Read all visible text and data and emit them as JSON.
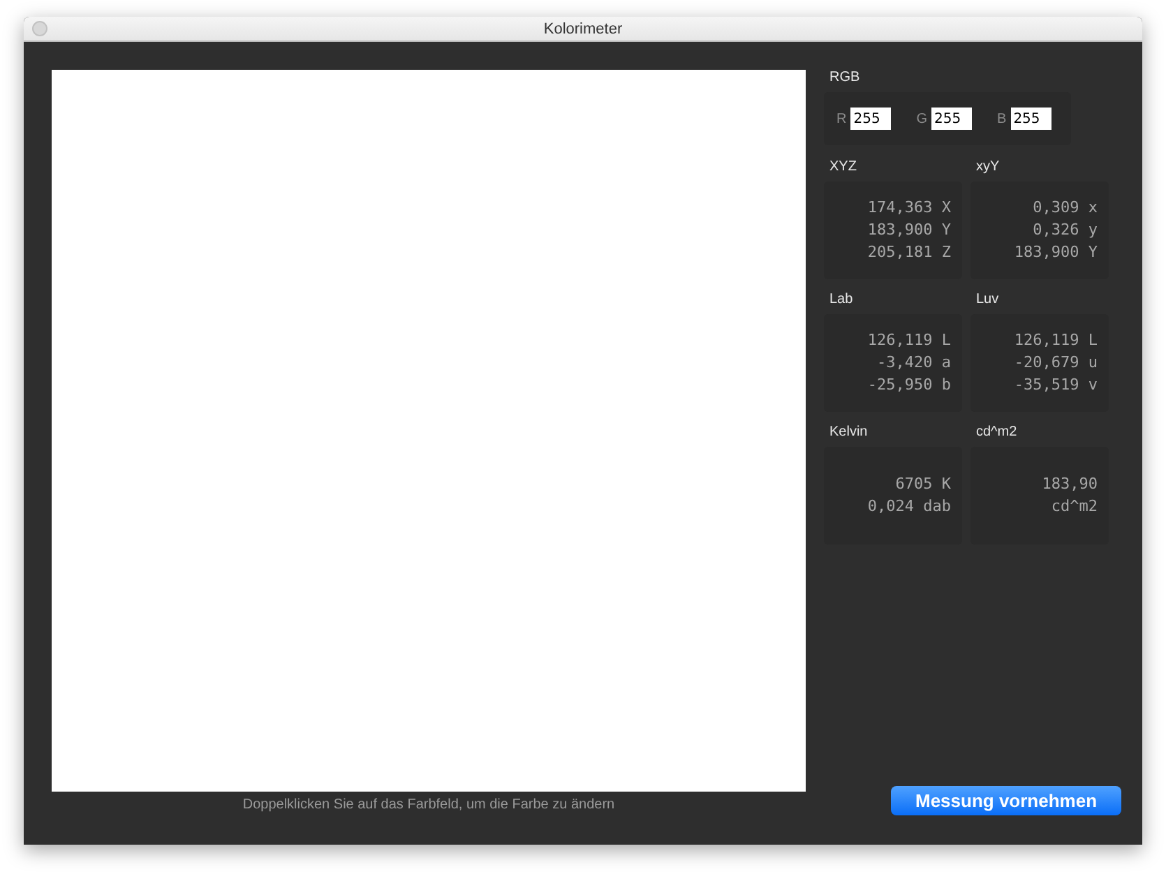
{
  "window": {
    "title": "Kolorimeter"
  },
  "rgb": {
    "title": "RGB",
    "channels": [
      {
        "label": "R",
        "value": "255"
      },
      {
        "label": "G",
        "value": "255"
      },
      {
        "label": "B",
        "value": "255"
      }
    ]
  },
  "panels": [
    {
      "title": "XYZ",
      "lines": [
        "174,363 X",
        "183,900 Y",
        "205,181 Z"
      ]
    },
    {
      "title": "xyY",
      "lines": [
        "0,309 x",
        "0,326 y",
        "183,900 Y"
      ]
    },
    {
      "title": "Lab",
      "lines": [
        "126,119 L",
        "-3,420 a",
        "-25,950 b"
      ]
    },
    {
      "title": "Luv",
      "lines": [
        "126,119 L",
        "-20,679 u",
        "-35,519 v"
      ]
    },
    {
      "title": "Kelvin",
      "lines": [
        "6705 K",
        "0,024 dab"
      ]
    },
    {
      "title": "cd^m2",
      "lines": [
        "183,90",
        "cd^m2"
      ]
    }
  ],
  "hint": "Doppelklicken Sie auf das Farbfeld, um die Farbe zu ändern",
  "measure_button": "Messung vornehmen"
}
